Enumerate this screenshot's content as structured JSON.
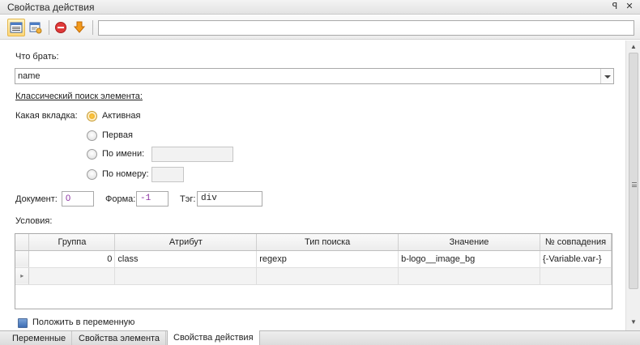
{
  "window": {
    "title": "Свойства действия",
    "pin_glyph": "ꟼ",
    "close_glyph": "✕"
  },
  "toolbar": {
    "buttons": [
      {
        "icon": "table-view-icon",
        "active": true
      },
      {
        "icon": "window-settings-icon",
        "active": false
      },
      {
        "icon": "stop-icon",
        "active": false
      },
      {
        "icon": "arrow-down-icon",
        "active": false
      }
    ],
    "input_value": ""
  },
  "form": {
    "what_take_label": "Что брать:",
    "what_take_value": "name",
    "classic_search_label": "Классический поиск элемента:",
    "tab_label": "Какая вкладка:",
    "tab_options": [
      {
        "label": "Активная",
        "checked": true
      },
      {
        "label": "Первая",
        "checked": false
      },
      {
        "label": "По имени:",
        "checked": false
      },
      {
        "label": "По номеру:",
        "checked": false
      }
    ],
    "by_name_value": "",
    "by_number_value": "",
    "document_label": "Документ:",
    "document_value": "0",
    "form_label": "Форма:",
    "form_value": "-1",
    "tag_label": "Тэг:",
    "tag_value": "div",
    "conditions_label": "Условия:"
  },
  "grid": {
    "columns": [
      "Группа",
      "Атрибут",
      "Тип поиска",
      "Значение",
      "№ совпадения"
    ],
    "rows": [
      [
        "0",
        "class",
        "regexp",
        "b-logo__image_bg",
        "{-Variable.var-}"
      ]
    ],
    "new_row_marker": "▸"
  },
  "checkbox": {
    "label": "Положить в переменную"
  },
  "tabs": [
    {
      "label": "Переменные",
      "active": false
    },
    {
      "label": "Свойства элемента",
      "active": false
    },
    {
      "label": "Свойства действия",
      "active": true
    }
  ],
  "colors": {
    "accent": "#ffd778",
    "purple_text": "#8a2fa0",
    "stop_red": "#e03a3a",
    "arrow_orange": "#f39a1c"
  }
}
